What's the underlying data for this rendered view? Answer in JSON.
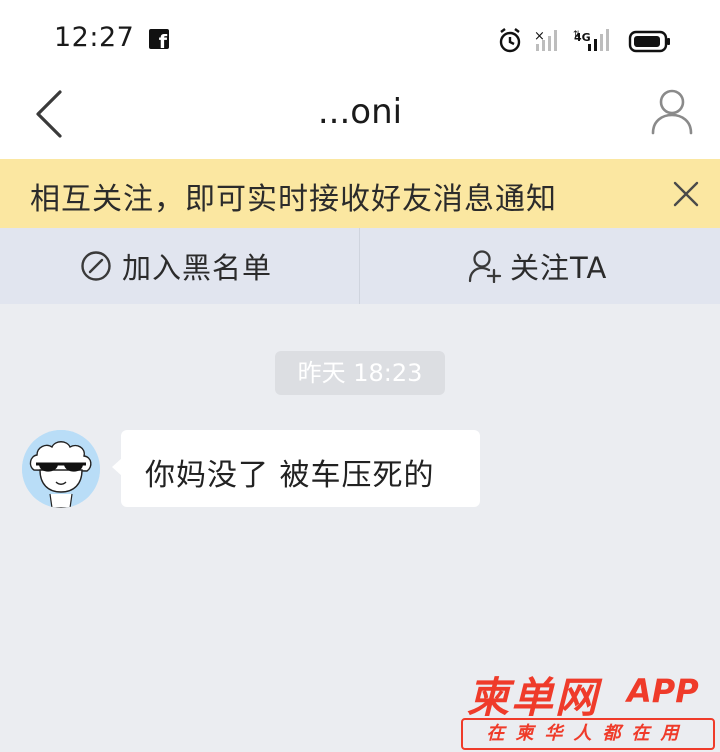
{
  "status_bar": {
    "time": "12:27",
    "fb_glyph": "f",
    "icons": [
      "facebook-icon",
      "alarm-icon",
      "signal-no-service-icon",
      "signal-4g-icon",
      "battery-icon"
    ],
    "network_label": "4G"
  },
  "nav": {
    "title": "...oni",
    "back_icon": "chevron-left-icon",
    "profile_icon": "user-outline-icon"
  },
  "notice": {
    "text": "相互关注，即可实时接收好友消息通知",
    "close_icon": "close-icon",
    "background": "#fbe7a1"
  },
  "actions": [
    {
      "label": "加入黑名单",
      "icon": "block-icon"
    },
    {
      "label": "关注TA",
      "icon": "add-user-icon"
    }
  ],
  "conversation": {
    "timestamp": "昨天 18:23",
    "messages": [
      {
        "sender": "other",
        "avatar": "sunglasses-avatar",
        "text": "你妈没了 被车压死的"
      }
    ]
  },
  "watermark": {
    "title": "柬单网",
    "app": "APP",
    "slogan": "在柬华人都在用",
    "color": "#ef3b2a"
  }
}
